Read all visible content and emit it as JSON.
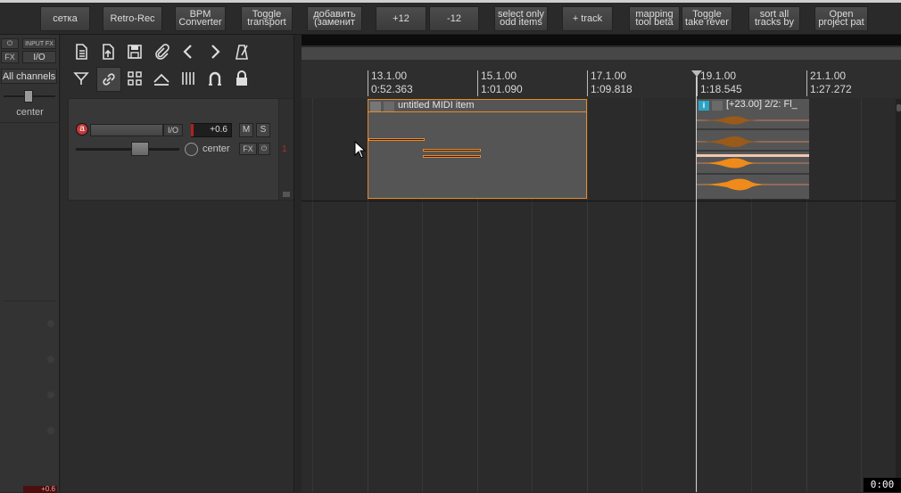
{
  "toolbar": {
    "buttons": [
      {
        "label": "сетка"
      },
      {
        "label": "Retro-Rec"
      },
      {
        "label": "BPM\nConverter"
      },
      {
        "label": "Toggle\ntransport"
      },
      {
        "label": "добавить\n(заменит"
      },
      {
        "label": "+12"
      },
      {
        "label": "-12"
      },
      {
        "label": "select only\nodd items"
      },
      {
        "label": "+ track"
      },
      {
        "label": "mapping\ntool beta"
      },
      {
        "label": "Toggle\ntake rever"
      },
      {
        "label": "sort all\ntracks by"
      },
      {
        "label": "Open\nproject pat"
      }
    ]
  },
  "master": {
    "fx_label": "FX",
    "input_fx_label": "INPUT FX",
    "io_label": "I/O",
    "channels_label": "All channels",
    "pan_label": "center",
    "volume_readout": "+0.6"
  },
  "track": {
    "number": "1",
    "io_label": "I/O",
    "volume": "+0.6",
    "mute_label": "M",
    "solo_label": "S",
    "fx_label": "FX",
    "pan_label": "center"
  },
  "ruler": {
    "marks": [
      {
        "bar": "13.1.00",
        "time": "0:52.363"
      },
      {
        "bar": "15.1.00",
        "time": "1:01.090"
      },
      {
        "bar": "17.1.00",
        "time": "1:09.818"
      },
      {
        "bar": "19.1.00",
        "time": "1:18.545"
      },
      {
        "bar": "21.1.00",
        "time": "1:27.272"
      }
    ]
  },
  "items": {
    "midi": {
      "name": "untitled MIDI item"
    },
    "audio": {
      "name": "[+23.00] 2/2: Fl_"
    }
  },
  "status": {
    "time": "0:00"
  },
  "colors": {
    "accent": "#e8892a",
    "item_bg": "#555555",
    "playhead": "#d0d0d0"
  }
}
